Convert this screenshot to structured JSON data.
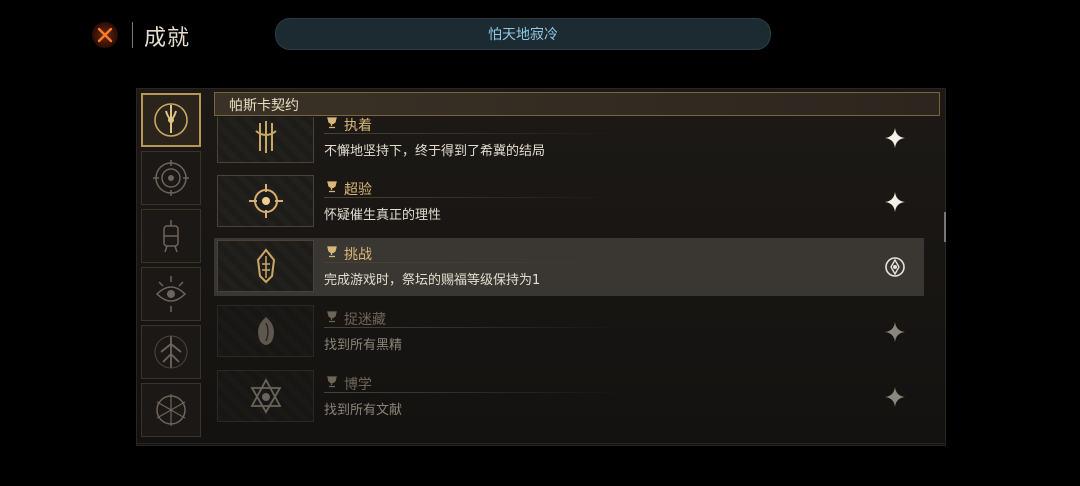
{
  "header": {
    "title": "成就",
    "player_name": "怕天地寂冷"
  },
  "categories": [
    {
      "icon": "pact-sigil-icon",
      "active": true
    },
    {
      "icon": "spiral-sigil-icon",
      "active": false
    },
    {
      "icon": "lantern-sigil-icon",
      "active": false
    },
    {
      "icon": "eye-sigil-icon",
      "active": false
    },
    {
      "icon": "tree-sigil-icon",
      "active": false
    },
    {
      "icon": "thorn-sigil-icon",
      "active": false
    }
  ],
  "list": {
    "section_title": "帕斯卡契约",
    "achievements": [
      {
        "title": "执着",
        "description": "不懈地坚持下，终于得到了希冀的结局",
        "status": "unlocked",
        "icon": "claw-emblem-icon"
      },
      {
        "title": "超验",
        "description": "怀疑催生真正的理性",
        "status": "unlocked",
        "icon": "target-emblem-icon"
      },
      {
        "title": "挑战",
        "description": "完成游戏时，祭坛的赐福等级保持为1",
        "status": "in-progress",
        "icon": "lantern-emblem-icon"
      },
      {
        "title": "捉迷藏",
        "description": "找到所有黑精",
        "status": "locked",
        "icon": "seed-emblem-icon"
      },
      {
        "title": "博学",
        "description": "找到所有文献",
        "status": "locked",
        "icon": "star-emblem-icon"
      }
    ]
  },
  "colors": {
    "accent_gold": "#d8b878",
    "player_name": "#8fc7e6",
    "close_orange": "#ff7a2a"
  }
}
